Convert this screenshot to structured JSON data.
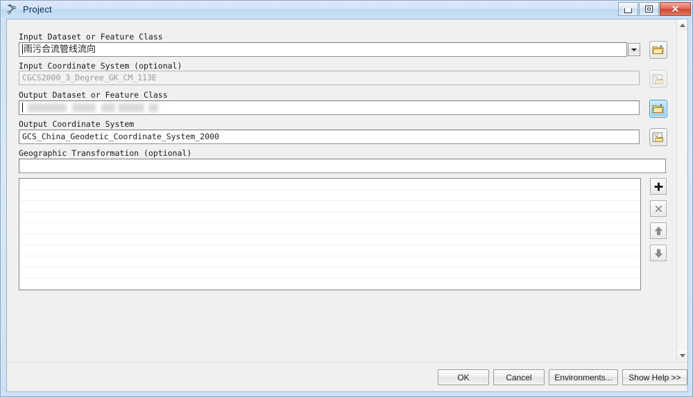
{
  "window": {
    "title": "Project",
    "icon": "hammer-tool-icon",
    "controls": {
      "minimize": "Minimize",
      "maximize": "Restore",
      "close": "Close"
    }
  },
  "form": {
    "fields": [
      {
        "label": "Input Dataset or Feature Class",
        "value": "雨污合流管线流向",
        "type": "combobox",
        "disabled": false,
        "redacted": false,
        "browse_icon": "open-folder-icon",
        "browse_state": "normal"
      },
      {
        "label": "Input Coordinate System (optional)",
        "value": "CGCS2000_3_Degree_GK_CM_113E",
        "type": "textbox",
        "disabled": true,
        "redacted": false,
        "browse_icon": "spatial-reference-icon",
        "browse_state": "disabled"
      },
      {
        "label": "Output Dataset or Feature Class",
        "value": "",
        "type": "textbox",
        "disabled": false,
        "redacted": true,
        "browse_icon": "open-folder-icon",
        "browse_state": "active"
      },
      {
        "label": "Output Coordinate System",
        "value": "GCS_China_Geodetic_Coordinate_System_2000",
        "type": "textbox",
        "disabled": false,
        "redacted": false,
        "browse_icon": "spatial-reference-icon",
        "browse_state": "normal"
      },
      {
        "label": "Geographic Transformation (optional)",
        "value": "",
        "type": "textbox",
        "disabled": false,
        "redacted": false,
        "browse_icon": "",
        "browse_state": "none"
      }
    ]
  },
  "transformation_list": {
    "items": [],
    "row_count": 10,
    "tools": [
      {
        "name": "add",
        "glyph": "+",
        "label": "Add Value"
      },
      {
        "name": "delete",
        "glyph": "×",
        "label": "Remove Value"
      },
      {
        "name": "move-up",
        "glyph": "↑",
        "label": "Move Up"
      },
      {
        "name": "move-down",
        "glyph": "↓",
        "label": "Move Down"
      }
    ]
  },
  "footer": {
    "buttons": [
      {
        "name": "ok",
        "label": "OK"
      },
      {
        "name": "cancel",
        "label": "Cancel"
      },
      {
        "name": "environments",
        "label": "Environments..."
      },
      {
        "name": "show-help",
        "label": "Show Help >>"
      }
    ]
  },
  "scrollbar": {
    "up_label": "Scroll Up",
    "down_label": "Scroll Down"
  },
  "colors": {
    "title_bar": "#cfe3f7",
    "close_button": "#cf4a33",
    "dialog_background": "#f0f0f0",
    "active_button_highlight": "#8fd2f4",
    "text": "#1a1a1a"
  }
}
